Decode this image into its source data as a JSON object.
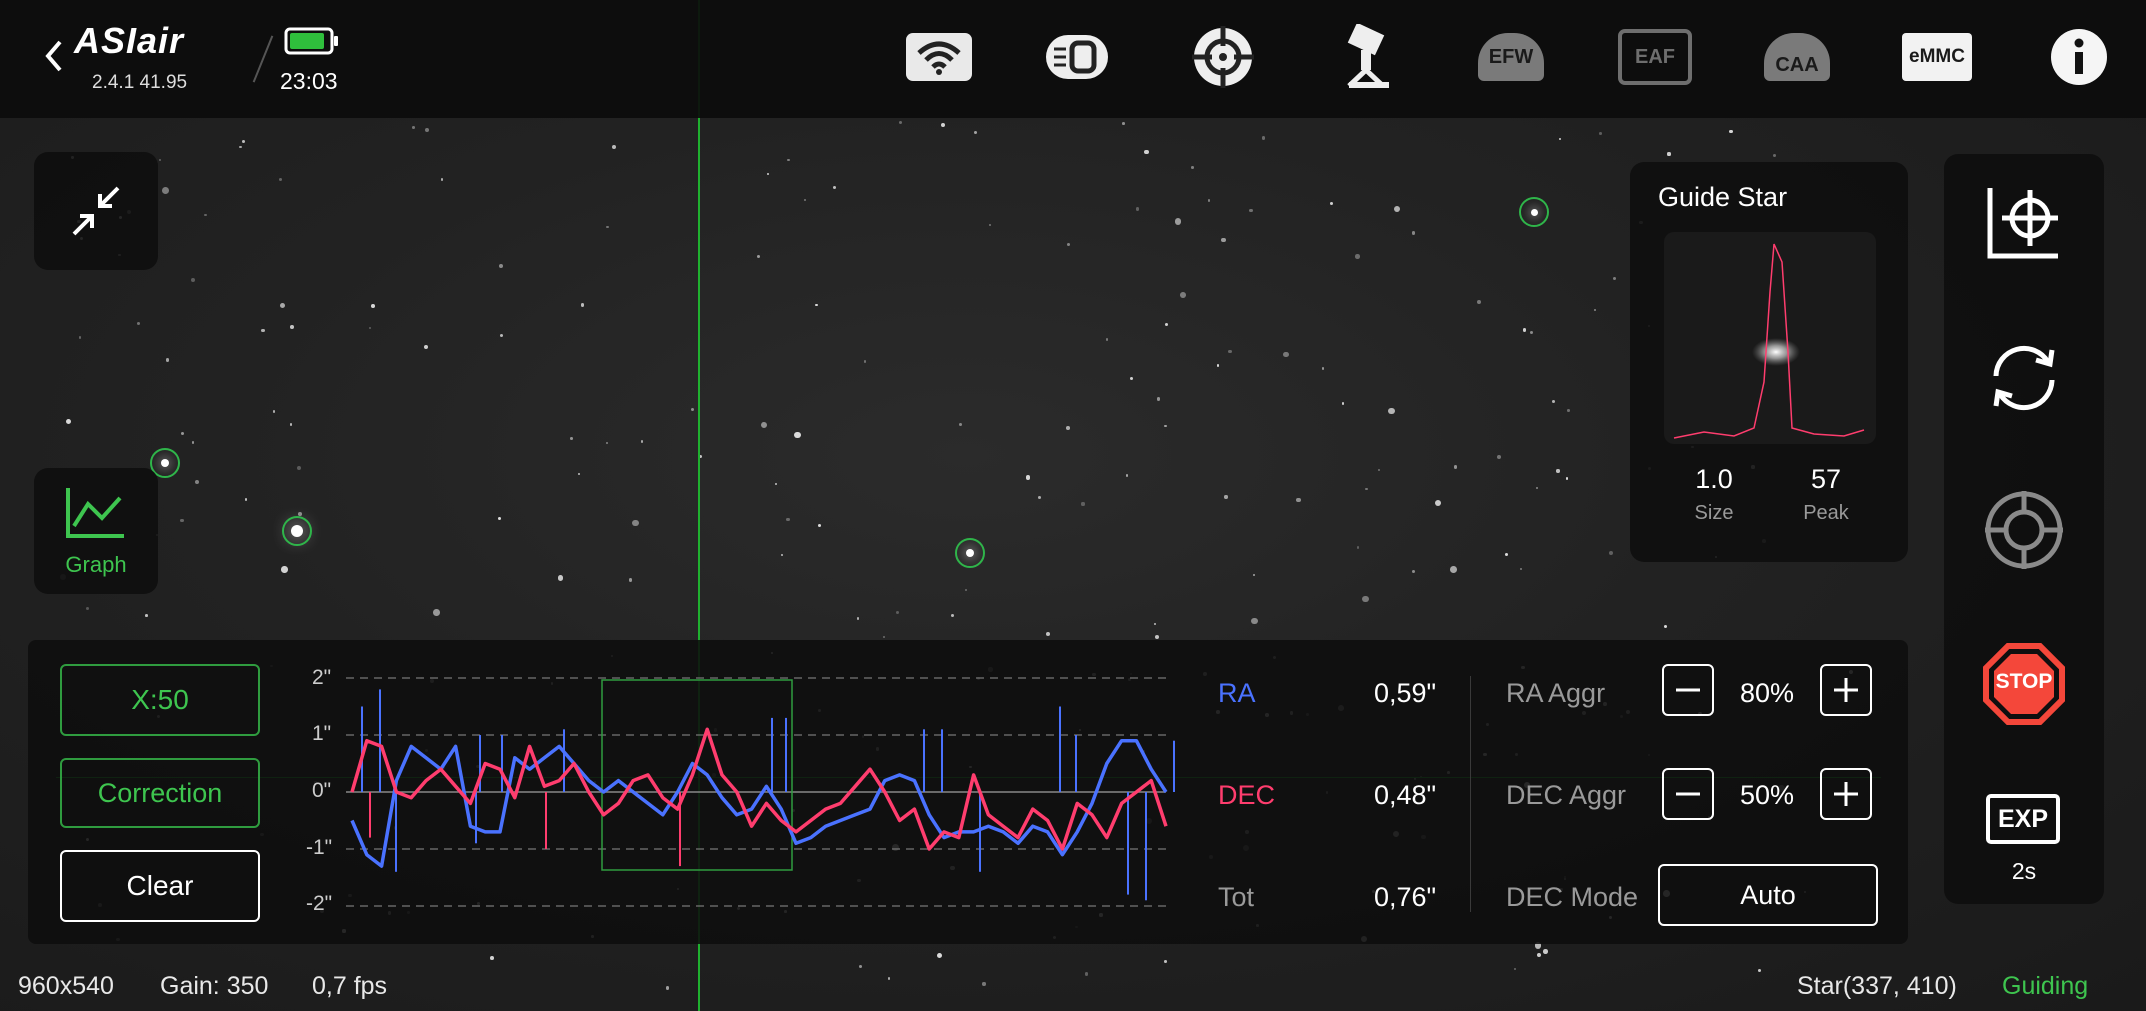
{
  "header": {
    "logo": "ASIair",
    "version": "2.4.1 41.95",
    "time": "23:03",
    "devices": [
      {
        "name": "wifi-icon"
      },
      {
        "name": "camera-icon"
      },
      {
        "name": "guide-camera-icon"
      },
      {
        "name": "telescope-mount-icon"
      },
      {
        "name": "filter-wheel-icon",
        "label": "EFW"
      },
      {
        "name": "focuser-icon",
        "label": "EAF"
      },
      {
        "name": "rotator-icon",
        "label": "CAA"
      },
      {
        "name": "storage-icon",
        "label": "eMMC"
      },
      {
        "name": "info-icon"
      }
    ]
  },
  "left_panel": {
    "graph_label": "Graph"
  },
  "guide_star": {
    "title": "Guide Star",
    "size_value": "1.0",
    "size_label": "Size",
    "peak_value": "57",
    "peak_label": "Peak"
  },
  "guide_graph": {
    "x_button": "X:50",
    "correction_button": "Correction",
    "clear_button": "Clear",
    "y_ticks": [
      "2\"",
      "1\"",
      "0\"",
      "-1\"",
      "-2\""
    ],
    "ra_label": "RA",
    "ra_value": "0,59\"",
    "dec_label": "DEC",
    "dec_value": "0,48\"",
    "tot_label": "Tot",
    "tot_value": "0,76\"",
    "ra_aggr_label": "RA Aggr",
    "ra_aggr_value": "80%",
    "dec_aggr_label": "DEC Aggr",
    "dec_aggr_value": "50%",
    "dec_mode_label": "DEC Mode",
    "dec_mode_value": "Auto"
  },
  "chart_data": {
    "type": "line",
    "ylim": [
      -2,
      2
    ],
    "series": [
      {
        "name": "RA",
        "color": "#4a72ff",
        "values": [
          -0.5,
          -1.1,
          -1.3,
          0.2,
          0.8,
          0.6,
          0.4,
          0.8,
          -0.6,
          -0.7,
          -0.7,
          0.6,
          0.4,
          0.6,
          0.8,
          0.5,
          0.2,
          0.0,
          0.2,
          0.0,
          -0.2,
          -0.4,
          0.0,
          0.5,
          0.3,
          -0.1,
          -0.4,
          -0.3,
          0.1,
          -0.3,
          -0.9,
          -0.8,
          -0.6,
          -0.5,
          -0.4,
          -0.3,
          0.2,
          0.3,
          0.2,
          -0.4,
          -0.8,
          -0.7,
          -0.7,
          -0.6,
          -0.7,
          -0.9,
          -0.6,
          -0.7,
          -1.1,
          -0.7,
          -0.2,
          0.5,
          0.9,
          0.9,
          0.4,
          0.0
        ]
      },
      {
        "name": "DEC",
        "color": "#ff3d6e",
        "values": [
          0.0,
          0.9,
          0.8,
          0.0,
          -0.1,
          0.2,
          0.4,
          0.1,
          -0.2,
          0.5,
          0.4,
          -0.1,
          0.8,
          0.1,
          0.2,
          0.5,
          0.0,
          -0.4,
          -0.2,
          0.2,
          0.3,
          -0.1,
          -0.3,
          0.3,
          1.1,
          0.3,
          0.0,
          -0.6,
          -0.2,
          -0.5,
          -0.7,
          -0.5,
          -0.3,
          -0.2,
          0.1,
          0.4,
          0.0,
          -0.5,
          -0.3,
          -1.0,
          -0.7,
          -0.8,
          0.3,
          -0.4,
          -0.6,
          -0.8,
          -0.3,
          -0.5,
          -1.0,
          -0.2,
          -0.4,
          -0.8,
          -0.2,
          0.0,
          0.2,
          -0.6
        ]
      }
    ]
  },
  "status_bar": {
    "resolution": "960x540",
    "gain": "Gain: 350",
    "fps": "0,7 fps",
    "star_pos": "Star(337, 410)",
    "state": "Guiding"
  },
  "right_panel": {
    "exp_label": "EXP",
    "exp_value": "2s",
    "stop_label": "STOP"
  }
}
